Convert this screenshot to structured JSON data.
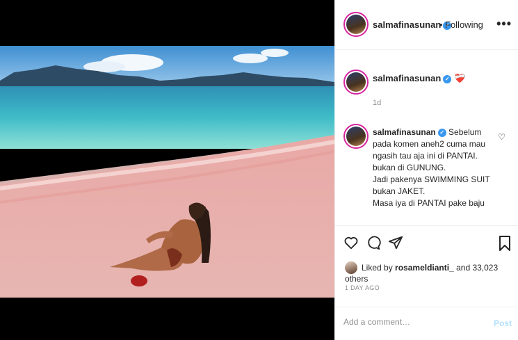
{
  "header": {
    "username": "salmafinasunan",
    "separator": "•",
    "follow_status": "Following",
    "more_label": "•••"
  },
  "comments": [
    {
      "username": "salmafinasunan",
      "emoji": "❤️‍🩹",
      "age": "1d"
    },
    {
      "username": "salmafinasunan",
      "text": "Sebelum pada komen aneh2 cuma mau ngasih tau aja ini di PANTAI. bukan di GUNUNG.\nJadi pakenya SWIMMING SUIT bukan JAKET.\nMasa iya di PANTAI pake baju"
    }
  ],
  "likes": {
    "prefix": "Liked by",
    "user": "rosameldianti_",
    "suffix": "and 33,023 others"
  },
  "posted": "1 DAY AGO",
  "add_comment": {
    "placeholder": "Add a comment…",
    "post_label": "Post"
  },
  "icons": {
    "verified": "verified-badge-icon",
    "like": "heart-icon",
    "comment": "comment-bubble-icon",
    "share": "paper-plane-icon",
    "save": "bookmark-icon",
    "more": "more-dots-icon"
  },
  "colors": {
    "accent": "#3897f0",
    "post_disabled": "#b2dffc",
    "secondary_text": "#8e8e8e"
  }
}
